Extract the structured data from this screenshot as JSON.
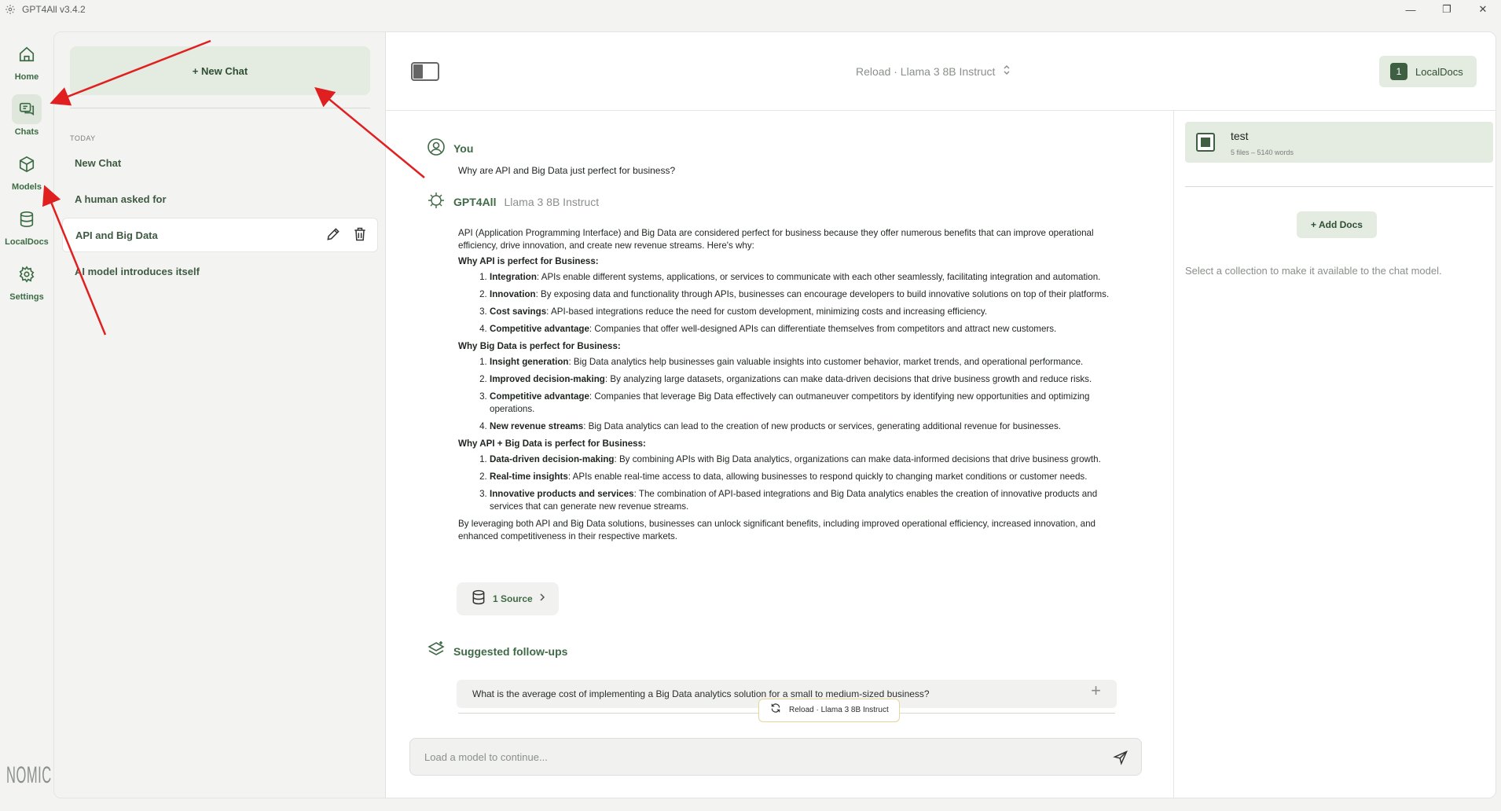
{
  "window": {
    "title": "GPT4All v3.4.2",
    "minimize": "—",
    "restore": "❐",
    "close": "✕"
  },
  "nav": [
    {
      "label": "Home",
      "icon": "home-icon"
    },
    {
      "label": "Chats",
      "icon": "chat-icon"
    },
    {
      "label": "Models",
      "icon": "cube-icon"
    },
    {
      "label": "LocalDocs",
      "icon": "database-icon"
    },
    {
      "label": "Settings",
      "icon": "gear-icon"
    }
  ],
  "brand": "NOMIC",
  "chatlist": {
    "new_chat": "+ New Chat",
    "section": "TODAY",
    "items": [
      "New Chat",
      "A human asked for",
      "API and Big Data",
      "AI model introduces itself"
    ]
  },
  "header": {
    "model": "Reload · Llama 3 8B Instruct",
    "localdocs_count": "1",
    "localdocs_label": "LocalDocs"
  },
  "conversation": {
    "user_name": "You",
    "user_message": "Why are API and Big Data just perfect for business?",
    "assistant_name": "GPT4All",
    "assistant_model": "Llama 3 8B Instruct",
    "intro": "API (Application Programming Interface) and Big Data are considered perfect for business because they offer numerous benefits that can improve operational efficiency, drive innovation, and create new revenue streams. Here's why:",
    "sections": [
      {
        "heading": "Why API is perfect for Business:",
        "items": [
          {
            "term": "Integration",
            "text": ": APIs enable different systems, applications, or services to communicate with each other seamlessly, facilitating integration and automation."
          },
          {
            "term": "Innovation",
            "text": ": By exposing data and functionality through APIs, businesses can encourage developers to build innovative solutions on top of their platforms."
          },
          {
            "term": "Cost savings",
            "text": ": API-based integrations reduce the need for custom development, minimizing costs and increasing efficiency."
          },
          {
            "term": "Competitive advantage",
            "text": ": Companies that offer well-designed APIs can differentiate themselves from competitors and attract new customers."
          }
        ]
      },
      {
        "heading": "Why Big Data is perfect for Business:",
        "items": [
          {
            "term": "Insight generation",
            "text": ": Big Data analytics help businesses gain valuable insights into customer behavior, market trends, and operational performance."
          },
          {
            "term": "Improved decision-making",
            "text": ": By analyzing large datasets, organizations can make data-driven decisions that drive business growth and reduce risks."
          },
          {
            "term": "Competitive advantage",
            "text": ": Companies that leverage Big Data effectively can outmaneuver competitors by identifying new opportunities and optimizing operations."
          },
          {
            "term": "New revenue streams",
            "text": ": Big Data analytics can lead to the creation of new products or services, generating additional revenue for businesses."
          }
        ]
      },
      {
        "heading": "Why API + Big Data is perfect for Business:",
        "items": [
          {
            "term": "Data-driven decision-making",
            "text": ": By combining APIs with Big Data analytics, organizations can make data-informed decisions that drive business growth."
          },
          {
            "term": "Real-time insights",
            "text": ": APIs enable real-time access to data, allowing businesses to respond quickly to changing market conditions or customer needs."
          },
          {
            "term": "Innovative products and services",
            "text": ": The combination of API-based integrations and Big Data analytics enables the creation of innovative products and services that can generate new revenue streams."
          }
        ]
      }
    ],
    "conclusion": "By leveraging both API and Big Data solutions, businesses can unlock significant benefits, including improved operational efficiency, increased innovation, and enhanced competitiveness in their respective markets.",
    "sources": "1 Source",
    "followups_title": "Suggested follow-ups",
    "followup": "What is the average cost of implementing a Big Data analytics solution for a small to medium-sized business?",
    "reload_toast": "Reload · Llama 3 8B Instruct",
    "input_placeholder": "Load a model to continue..."
  },
  "localdocs": {
    "collection_name": "test",
    "collection_meta": "5 files – 5140 words",
    "add_docs": "+ Add Docs",
    "hint": "Select a collection to make it available to the chat model."
  },
  "colors": {
    "accent": "#3f6a45",
    "accent_bg": "#e4ebe1",
    "arrow": "#e02020"
  }
}
